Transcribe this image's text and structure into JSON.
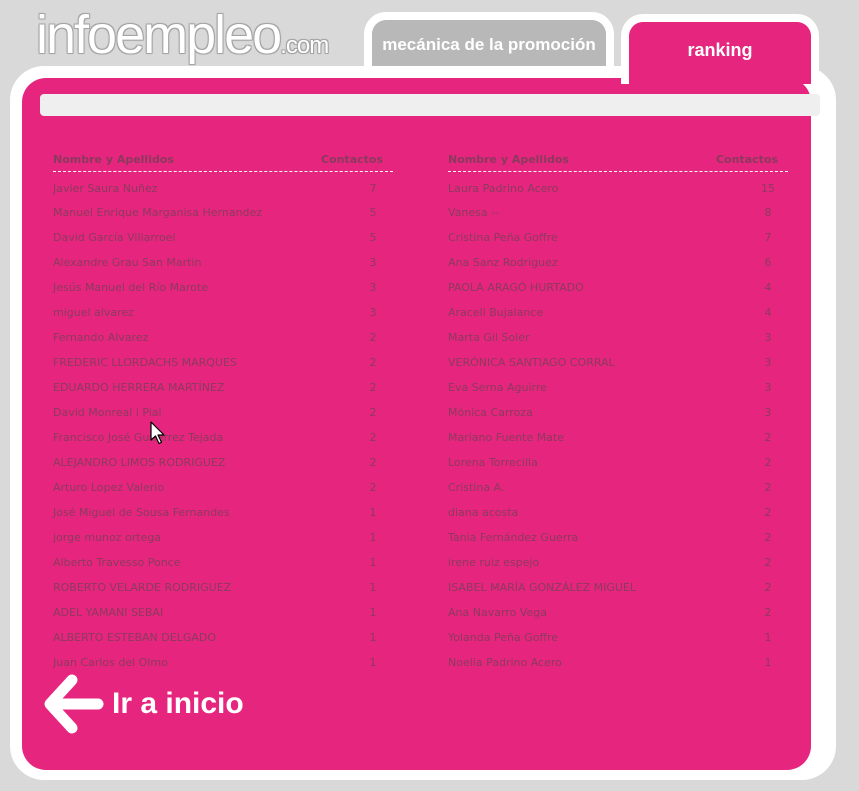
{
  "logo": {
    "main": "infoempleo",
    "suffix": ".com"
  },
  "tabs": [
    {
      "label": "mecánica de la promoción"
    },
    {
      "label": "ranking"
    }
  ],
  "ranking": {
    "left": {
      "header_name": "Nombre y Apellidos",
      "header_count": "Contactos",
      "rows": [
        {
          "name": "Javier Saura Nuñez",
          "count": "7"
        },
        {
          "name": "Manuel Enrique Marganisa Hernandez",
          "count": "5"
        },
        {
          "name": "David García Villarroel",
          "count": "5"
        },
        {
          "name": "Alexandre Grau San Martin",
          "count": "3"
        },
        {
          "name": "Jesús Manuel del Río Marote",
          "count": "3"
        },
        {
          "name": "miguel alvarez",
          "count": "3"
        },
        {
          "name": "Fernando Alvarez",
          "count": "2"
        },
        {
          "name": "FREDERIC LLORDACHS MARQUES",
          "count": "2"
        },
        {
          "name": "EDUARDO HERRERA MARTÍNEZ",
          "count": "2"
        },
        {
          "name": "David Monreal i Pial",
          "count": "2"
        },
        {
          "name": "Francisco José Gutiérrez Tejada",
          "count": "2"
        },
        {
          "name": "ALEJANDRO LIMOS RODRIGUEZ",
          "count": "2"
        },
        {
          "name": "Arturo Lopez Valerio",
          "count": "2"
        },
        {
          "name": "José Miguel de Sousa Fernandes",
          "count": "1"
        },
        {
          "name": "jorge munoz ortega",
          "count": "1"
        },
        {
          "name": "Alberto Travesso Ponce",
          "count": "1"
        },
        {
          "name": "ROBERTO VELARDE RODRIGUEZ",
          "count": "1"
        },
        {
          "name": "ADEL YAMANI SEBAI",
          "count": "1"
        },
        {
          "name": "ALBERTO ESTEBAN DELGADO",
          "count": "1"
        },
        {
          "name": "Juan Carlos del Olmo",
          "count": "1"
        }
      ]
    },
    "right": {
      "header_name": "Nombre y Apellidos",
      "header_count": "Contactos",
      "rows": [
        {
          "name": "Laura Padrino Acero",
          "count": "15"
        },
        {
          "name": "Vanesa --",
          "count": "8"
        },
        {
          "name": "Cristina Peña Goffre",
          "count": "7"
        },
        {
          "name": "Ana Sanz Rodriguez",
          "count": "6"
        },
        {
          "name": "PAOLA ARAGÓ HURTADO",
          "count": "4"
        },
        {
          "name": "Araceli Bujalance",
          "count": "4"
        },
        {
          "name": "Marta Gil Soler",
          "count": "3"
        },
        {
          "name": "VERÓNICA SANTIAGO CORRAL",
          "count": "3"
        },
        {
          "name": "Eva Serna Aguirre",
          "count": "3"
        },
        {
          "name": "Mónica Carroza",
          "count": "3"
        },
        {
          "name": "Mariano Fuente Mate",
          "count": "2"
        },
        {
          "name": "Lorena Torrecilla",
          "count": "2"
        },
        {
          "name": "Cristina A.",
          "count": "2"
        },
        {
          "name": "diana acosta",
          "count": "2"
        },
        {
          "name": "Tania Fernández Guerra",
          "count": "2"
        },
        {
          "name": "irene ruiz espejo",
          "count": "2"
        },
        {
          "name": "ISABEL MARÍA GONZÁLEZ MIGUEL",
          "count": "2"
        },
        {
          "name": "Ana Navarro Vega",
          "count": "2"
        },
        {
          "name": "Yolanda Peña Goffre",
          "count": "1"
        },
        {
          "name": "Noelia Padrino Acero",
          "count": "1"
        }
      ]
    }
  },
  "back_link": {
    "label": "Ir a inicio",
    "icon": "arrow-left-icon"
  },
  "colors": {
    "accent": "#e6267e",
    "tab_inactive": "#b8b8b8",
    "background": "#d9d9d9"
  }
}
